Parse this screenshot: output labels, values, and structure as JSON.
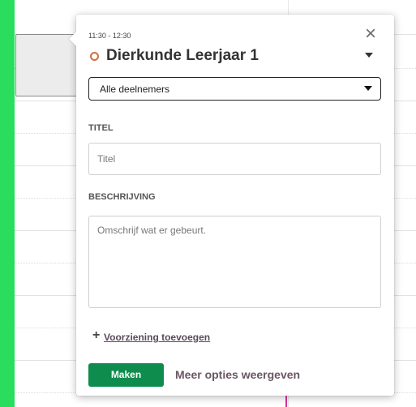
{
  "event": {
    "time": "11:30 - 12:30",
    "calendar_name": "Dierkunde Leerjaar 1",
    "status_color": "#d2713a"
  },
  "participants": {
    "selected": "Alle deelnemers"
  },
  "title_field": {
    "label": "TITEL",
    "placeholder": "Titel",
    "value": ""
  },
  "description_field": {
    "label": "BESCHRIJVING",
    "placeholder": "Omschrijf wat er gebeurt.",
    "value": ""
  },
  "actions": {
    "close_symbol": "×",
    "add_symbol": "+",
    "add_resource": "Voorziening toevoegen",
    "create": "Maken",
    "more_options": "Meer opties weergeven"
  },
  "colors": {
    "accent": "#0e8c4d",
    "background": "#2bdd5c",
    "marker": "#d8359a"
  }
}
